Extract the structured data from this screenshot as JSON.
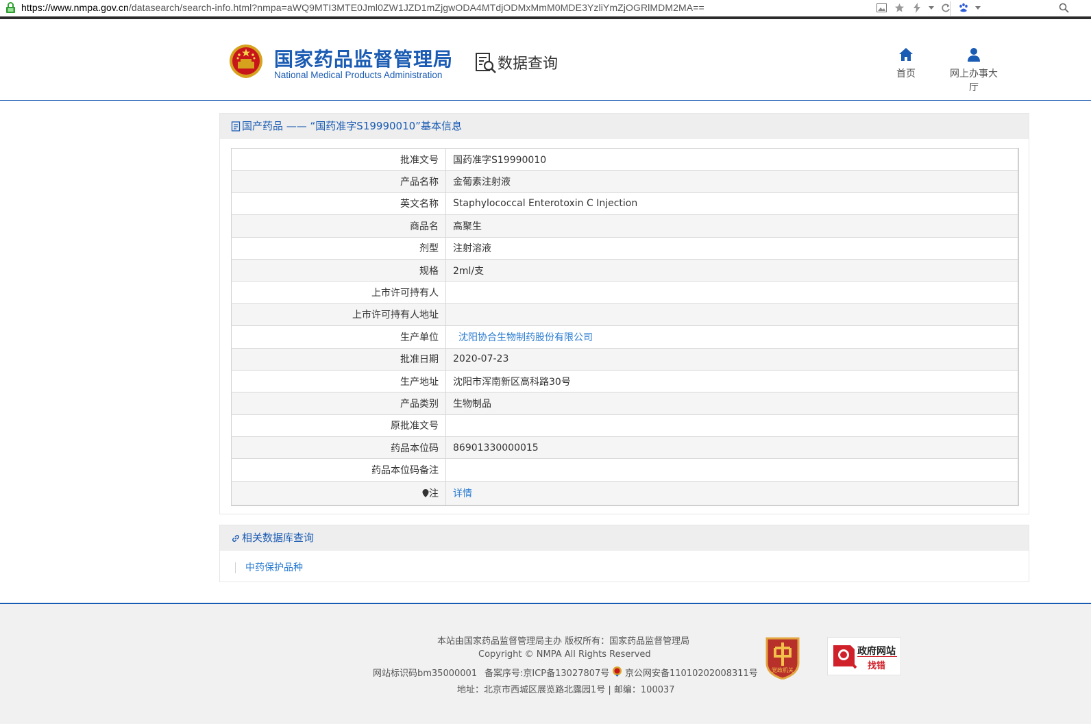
{
  "browser": {
    "url_host": "https://www.nmpa.gov.cn",
    "url_rest": "/datasearch/search-info.html?nmpa=aWQ9MTI3MTE0Jml0ZW1JZD1mZjgwODA4MTdjODMxMmM0MDE3YzliYmZjOGRlMDM2MA=="
  },
  "header": {
    "brand_cn": "国家药品监督管理局",
    "brand_en": "National Medical Products Administration",
    "section_title": "数据查询",
    "nav": [
      {
        "label": "首页",
        "icon": "home-icon"
      },
      {
        "label": "网上办事大厅",
        "icon": "user-icon"
      }
    ]
  },
  "info_panel": {
    "title": "国产药品 —— “国药准字S19990010”基本信息",
    "rows": [
      {
        "key": "批准文号",
        "value": "国药准字S19990010"
      },
      {
        "key": "产品名称",
        "value": "金葡素注射液"
      },
      {
        "key": "英文名称",
        "value": "Staphylococcal Enterotoxin C Injection"
      },
      {
        "key": "商品名",
        "value": "高聚生"
      },
      {
        "key": "剂型",
        "value": "注射溶液"
      },
      {
        "key": "规格",
        "value": "2ml/支"
      },
      {
        "key": "上市许可持有人",
        "value": ""
      },
      {
        "key": "上市许可持有人地址",
        "value": ""
      },
      {
        "key": "生产单位",
        "value": "沈阳协合生物制药股份有限公司"
      },
      {
        "key": "批准日期",
        "value": "2020-07-23"
      },
      {
        "key": "生产地址",
        "value": "沈阳市浑南新区高科路30号"
      },
      {
        "key": "产品类别",
        "value": "生物制品"
      },
      {
        "key": "原批准文号",
        "value": ""
      },
      {
        "key": "药品本位码",
        "value": "86901330000015"
      },
      {
        "key": "药品本位码备注",
        "value": ""
      },
      {
        "key": "注",
        "value": "详情"
      }
    ]
  },
  "related_panel": {
    "title": "相关数据库查询",
    "link": "中药保护品种"
  },
  "footer": {
    "line1": "本站由国家药品监督管理局主办 版权所有：国家药品监督管理局",
    "line2": "Copyright © NMPA All Rights Reserved",
    "site_id": "网站标识码bm35000001",
    "icp": "备案序号:京ICP备13027807号",
    "police": "京公网安备11010202008311号",
    "address": "地址：北京市西城区展览路北露园1号 | 邮编：100037",
    "badge1_text": "党政机关",
    "badge2_title": "政府网站",
    "badge2_sub": "找错"
  },
  "colors": {
    "brand_blue": "#1a5bb3",
    "link_blue": "#2a7bd1",
    "panel_header_bg": "#eeeeee"
  }
}
